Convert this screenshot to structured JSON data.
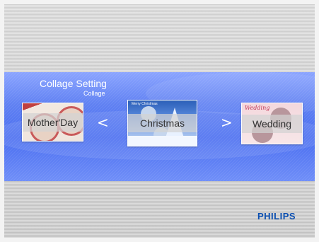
{
  "screen": {
    "title": "Collage Setting",
    "subtitle": "Collage"
  },
  "carousel": {
    "items": [
      {
        "label": "Mother'Day"
      },
      {
        "label": "Christmas"
      },
      {
        "label": "Wedding"
      }
    ],
    "prev_icon": "chevron-left-icon",
    "next_icon": "chevron-right-icon",
    "prev_glyph": "<",
    "next_glyph": ">"
  },
  "thumbnails": {
    "christmas_header": "Merry Christmas",
    "wedding_header": "Wedding"
  },
  "brand": {
    "logo": "PHILIPS",
    "color": "#0b4fb1"
  },
  "colors": {
    "band": "#4a6ef0",
    "background": "#d2d2d2"
  }
}
